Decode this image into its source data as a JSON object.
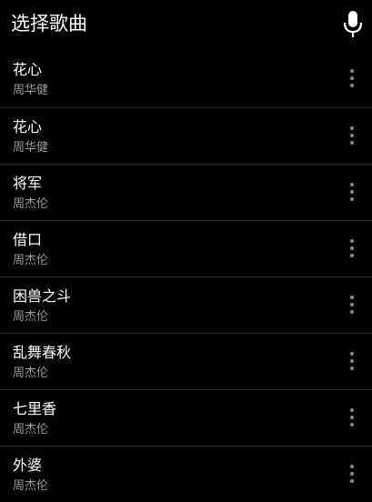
{
  "header": {
    "title": "选择歌曲",
    "mic_icon": "microphone-icon"
  },
  "colors": {
    "background": "#000000",
    "title_text": "#ffffff",
    "artist_text": "#9a9a9a",
    "divider": "#2e2e2e",
    "overflow_dots": "#8a8a8a"
  },
  "songs": [
    {
      "title": "花心",
      "artist": "周华健"
    },
    {
      "title": "花心",
      "artist": "周华健"
    },
    {
      "title": "将军",
      "artist": "周杰伦"
    },
    {
      "title": "借口",
      "artist": "周杰伦"
    },
    {
      "title": "困兽之斗",
      "artist": "周杰伦"
    },
    {
      "title": "乱舞春秋",
      "artist": "周杰伦"
    },
    {
      "title": "七里香",
      "artist": "周杰伦"
    },
    {
      "title": "外婆",
      "artist": "周杰伦"
    }
  ],
  "row_action_icon": "more-vertical-icon"
}
